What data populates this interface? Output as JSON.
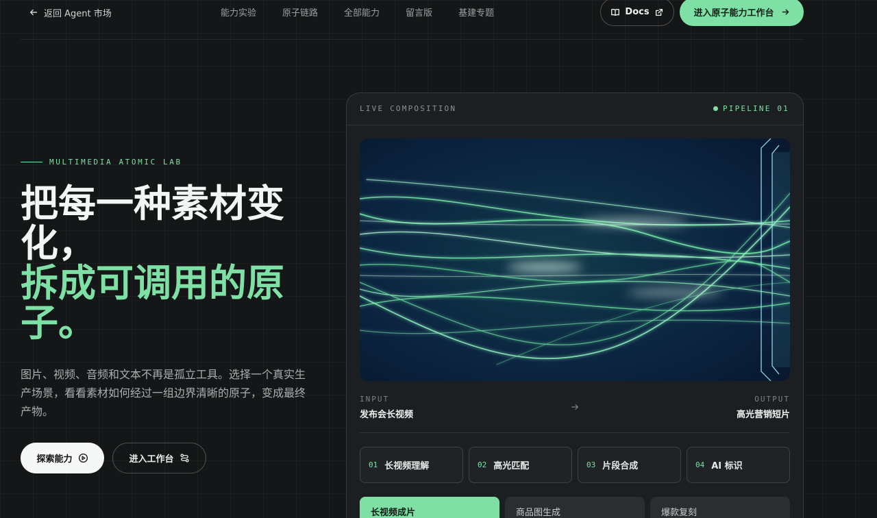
{
  "nav": {
    "back_label": "返回 Agent 市场",
    "links": [
      "能力实验",
      "原子链路",
      "全部能力",
      "留言版",
      "基建专题"
    ],
    "docs_label": "Docs",
    "workspace_label": "进入原子能力工作台"
  },
  "hero": {
    "eyebrow": "MULTIMEDIA ATOMIC LAB",
    "headline_line1": "把每一种素材变化，",
    "headline_line2": "拆成可调用的原子。",
    "lede": "图片、视频、音频和文本不再是孤立工具。选择一个真实生产场景，看看素材如何经过一组边界清晰的原子，变成最终产物。",
    "explore_label": "探索能力",
    "enter_label": "进入工作台"
  },
  "panel": {
    "live_label": "LIVE COMPOSITION",
    "pipeline_label": "PIPELINE 01",
    "input_label": "INPUT",
    "input_value": "发布会长视频",
    "output_label": "OUTPUT",
    "output_value": "高光营销短片",
    "steps": [
      {
        "num": "01",
        "name": "长视频理解"
      },
      {
        "num": "02",
        "name": "高光匹配"
      },
      {
        "num": "03",
        "name": "片段合成"
      },
      {
        "num": "04",
        "name": "AI 标识"
      }
    ],
    "tabs": [
      "长视频成片",
      "商品图生成",
      "爆款复刻"
    ],
    "active_tab": 0
  },
  "colors": {
    "accent": "#7fe0a6",
    "background": "#141617",
    "panel": "#1c1f21"
  }
}
